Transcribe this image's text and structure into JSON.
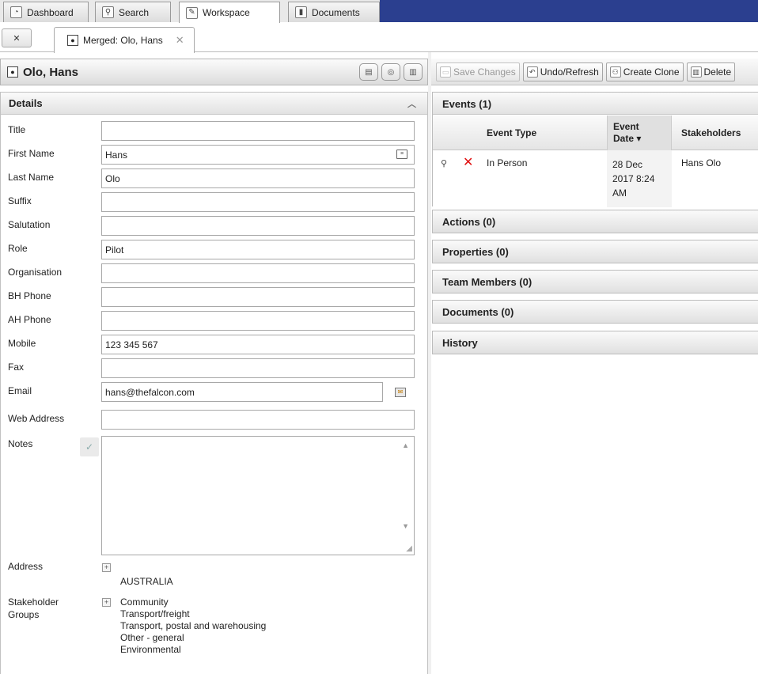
{
  "tabs": [
    {
      "label": "Dashboard",
      "icon": "dashboard-icon"
    },
    {
      "label": "Search",
      "icon": "search-icon"
    },
    {
      "label": "Workspace",
      "icon": "pencil-icon",
      "active": true
    },
    {
      "label": "Documents",
      "icon": "document-icon"
    }
  ],
  "subtabs": {
    "merged_label": "Merged: Olo, Hans",
    "close_glyph": "✕"
  },
  "contact": {
    "name": "Olo, Hans"
  },
  "details": {
    "title": "Details",
    "fields": {
      "title": {
        "label": "Title",
        "value": ""
      },
      "first_name": {
        "label": "First Name",
        "value": "Hans"
      },
      "last_name": {
        "label": "Last Name",
        "value": "Olo"
      },
      "suffix": {
        "label": "Suffix",
        "value": ""
      },
      "salutation": {
        "label": "Salutation",
        "value": ""
      },
      "role": {
        "label": "Role",
        "value": "Pilot"
      },
      "organisation": {
        "label": "Organisation",
        "value": ""
      },
      "bh_phone": {
        "label": "BH Phone",
        "value": ""
      },
      "ah_phone": {
        "label": "AH Phone",
        "value": ""
      },
      "mobile": {
        "label": "Mobile",
        "value": "123 345 567"
      },
      "fax": {
        "label": "Fax",
        "value": ""
      },
      "email": {
        "label": "Email",
        "value": "hans@thefalcon.com"
      },
      "web_address": {
        "label": "Web Address",
        "value": ""
      },
      "notes": {
        "label": "Notes",
        "value": ""
      }
    },
    "address": {
      "label": "Address",
      "value": "AUSTRALIA"
    },
    "stakeholder_groups": {
      "label_line1": "Stakeholder",
      "label_line2": "Groups",
      "items": [
        "Community",
        "Transport/freight",
        "Transport, postal and warehousing",
        "Other - general",
        "Environmental"
      ]
    }
  },
  "toolbar": {
    "save_label": "Save Changes",
    "undo_label": "Undo/Refresh",
    "clone_label": "Create Clone",
    "delete_label": "Delete"
  },
  "events": {
    "title": "Events (1)",
    "columns": {
      "event_type": "Event Type",
      "event_date_line1": "Event",
      "event_date_line2": "Date ▾",
      "stakeholders": "Stakeholders"
    },
    "rows": [
      {
        "event_type": "In Person",
        "date_line1": "28 Dec",
        "date_line2": "2017 8:24",
        "date_line3": "AM",
        "stakeholders": "Hans Olo"
      }
    ]
  },
  "sections": {
    "actions": "Actions (0)",
    "properties": "Properties (0)",
    "team_members": "Team Members (0)",
    "documents": "Documents (0)",
    "history": "History"
  },
  "colors": {
    "topbar_blue": "#2b3f8f",
    "delete_red": "#e01010"
  }
}
